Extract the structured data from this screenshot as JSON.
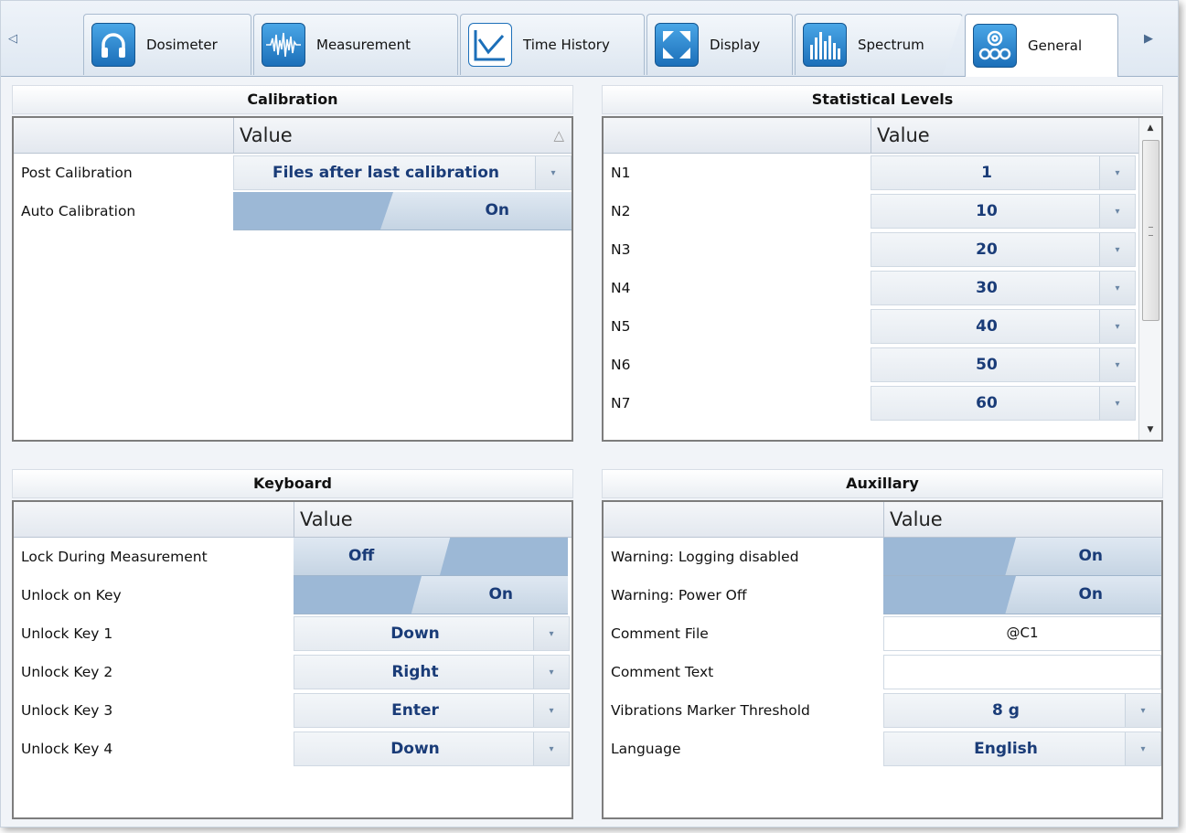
{
  "tabs": [
    {
      "label": "Dosimeter",
      "icon": "headphones-icon"
    },
    {
      "label": "Measurement",
      "icon": "waveform-icon"
    },
    {
      "label": "Time History",
      "icon": "line-graph-icon"
    },
    {
      "label": "Display",
      "icon": "expand-arrows-icon"
    },
    {
      "label": "Spectrum",
      "icon": "spectrum-bars-icon"
    },
    {
      "label": "General",
      "icon": "gears-icon"
    }
  ],
  "scroll_left_glyph": "◁",
  "scroll_right_glyph": "▶",
  "calibration": {
    "title": "Calibration",
    "value_header": "Value",
    "sort_glyph": "△",
    "rows": [
      {
        "label": "Post Calibration",
        "value": "Files after last calibration"
      },
      {
        "label": "Auto Calibration",
        "value": "On"
      }
    ]
  },
  "statistical": {
    "title": "Statistical Levels",
    "value_header": "Value",
    "rows": [
      {
        "label": "N1",
        "value": "1"
      },
      {
        "label": "N2",
        "value": "10"
      },
      {
        "label": "N3",
        "value": "20"
      },
      {
        "label": "N4",
        "value": "30"
      },
      {
        "label": "N5",
        "value": "40"
      },
      {
        "label": "N6",
        "value": "50"
      },
      {
        "label": "N7",
        "value": "60"
      }
    ]
  },
  "keyboard": {
    "title": "Keyboard",
    "value_header": "Value",
    "rows": [
      {
        "label": "Lock During Measurement",
        "value": "Off"
      },
      {
        "label": "Unlock on Key",
        "value": "On"
      },
      {
        "label": "Unlock Key 1",
        "value": "Down"
      },
      {
        "label": "Unlock Key 2",
        "value": "Right"
      },
      {
        "label": "Unlock Key 3",
        "value": "Enter"
      },
      {
        "label": "Unlock Key 4",
        "value": "Down"
      }
    ]
  },
  "auxillary": {
    "title": "Auxillary",
    "value_header": "Value",
    "rows": [
      {
        "label": "Warning: Logging disabled",
        "value": "On"
      },
      {
        "label": "Warning: Power Off",
        "value": "On"
      },
      {
        "label": "Comment File",
        "value": "@C1"
      },
      {
        "label": "Comment Text",
        "value": ""
      },
      {
        "label": "Vibrations Marker Threshold",
        "value": "8 g"
      },
      {
        "label": "Language",
        "value": "English"
      }
    ]
  },
  "dropdown_glyph": "▾",
  "colors": {
    "value_text": "#1a3c78",
    "toggle_thumb": "#9cb8d6",
    "icon_blue": "#1c6fb9"
  }
}
